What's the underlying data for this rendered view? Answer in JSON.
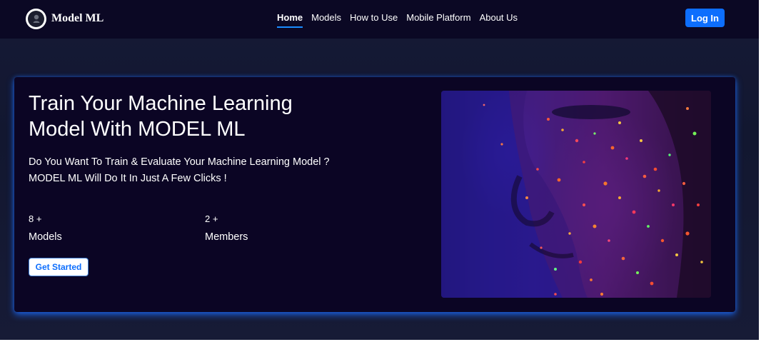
{
  "brand": {
    "name": "Model ML",
    "icon": "brain-logo-icon"
  },
  "nav": {
    "links": [
      {
        "label": "Home",
        "active": true
      },
      {
        "label": "Models",
        "active": false
      },
      {
        "label": "How to Use",
        "active": false
      },
      {
        "label": "Mobile Platform",
        "active": false
      },
      {
        "label": "About Us",
        "active": false
      }
    ],
    "login_label": "Log In"
  },
  "hero": {
    "title_line1": "Train Your Machine Learning",
    "title_line2": "Model With MODEL ML",
    "subtitle_line1": "Do You Want To Train & Evaluate Your Machine Learning Model ?",
    "subtitle_line2": "MODEL ML Will Do It In Just A Few Clicks !",
    "stats": [
      {
        "value": "8 +",
        "label": "Models"
      },
      {
        "value": "2 +",
        "label": "Members"
      }
    ],
    "cta_label": "Get Started"
  },
  "colors": {
    "navbar_bg": "#0b0824",
    "hero_bg": "#0b0524",
    "accent": "#0d6efd",
    "glow": "#1c6eff"
  }
}
